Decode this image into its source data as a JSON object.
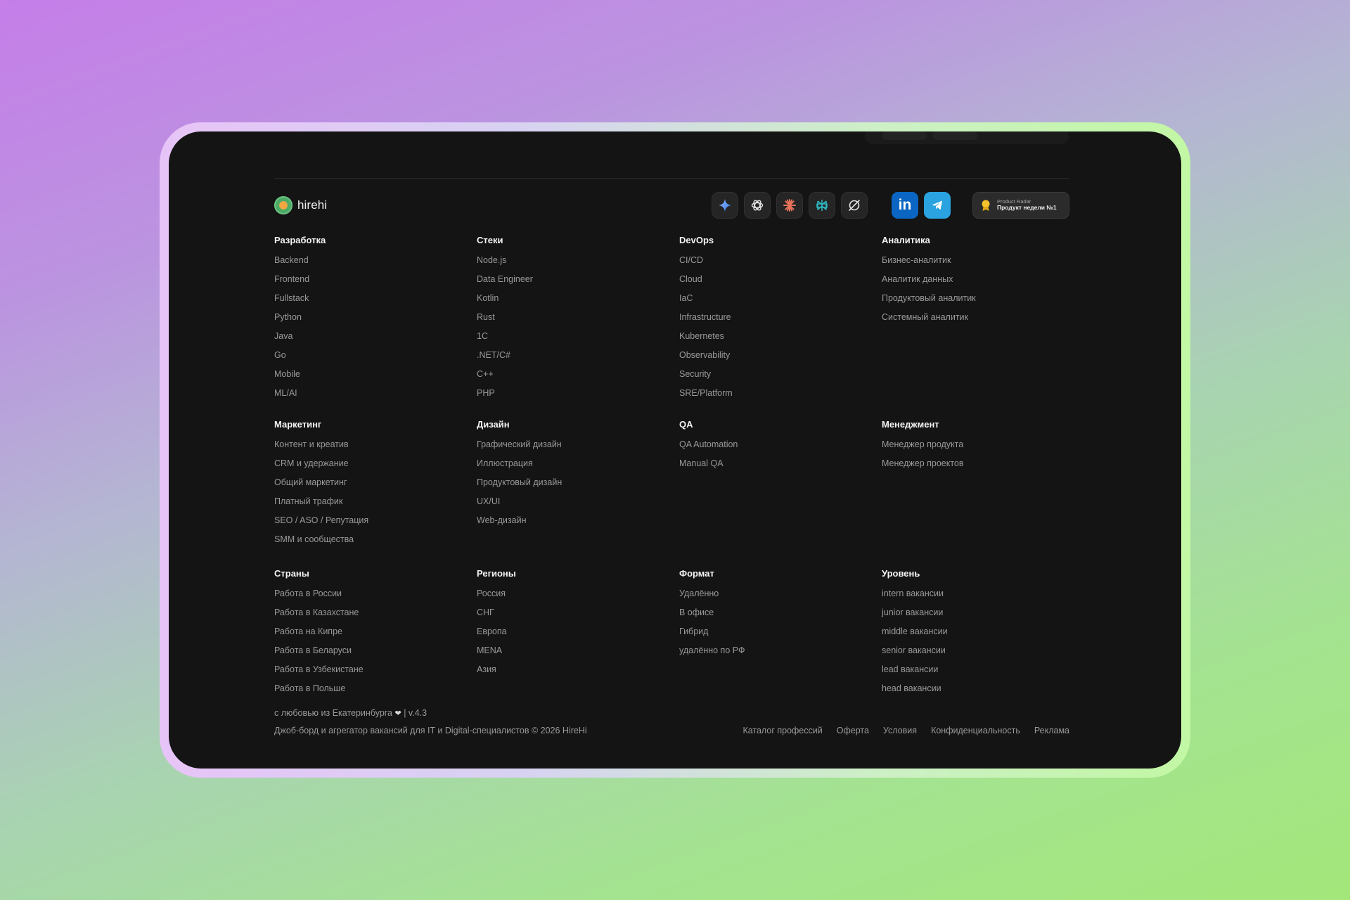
{
  "brand": {
    "name": "hirehi"
  },
  "ai_buttons": [
    {
      "icon": "sparkle-icon",
      "color": "#4f8ff7"
    },
    {
      "icon": "openai-icon",
      "color": "#e6e6e6"
    },
    {
      "icon": "asterisk-icon",
      "color": "#e8735a"
    },
    {
      "icon": "perplexity-icon",
      "color": "#2fb7c2"
    },
    {
      "icon": "grok-icon",
      "color": "#e6e6e6"
    }
  ],
  "social": {
    "linkedin_label": "in",
    "linkedin_color": "#0a66c2",
    "telegram_color": "#2aa3e0"
  },
  "product_radar": {
    "small": "Product Radar",
    "big": "Продукт недели №1"
  },
  "sections": [
    {
      "title": "Разработка",
      "items": [
        "Backend",
        "Frontend",
        "Fullstack",
        "Python",
        "Java",
        "Go",
        "Mobile",
        "ML/AI"
      ]
    },
    {
      "title": "Стеки",
      "items": [
        "Node.js",
        "Data Engineer",
        "Kotlin",
        "Rust",
        "1С",
        ".NET/C#",
        "C++",
        "PHP"
      ]
    },
    {
      "title": "DevOps",
      "items": [
        "CI/CD",
        "Cloud",
        "IaC",
        "Infrastructure",
        "Kubernetes",
        "Observability",
        "Security",
        "SRE/Platform"
      ]
    },
    {
      "title": "Аналитика",
      "items": [
        "Бизнес-аналитик",
        "Аналитик данных",
        "Продуктовый аналитик",
        "Системный аналитик"
      ]
    },
    {
      "title": "Маркетинг",
      "items": [
        "Контент и креатив",
        "CRM и удержание",
        "Общий маркетинг",
        "Платный трафик",
        "SEO / ASO / Репутация",
        "SMM и сообщества"
      ]
    },
    {
      "title": "Дизайн",
      "items": [
        "Графический дизайн",
        "Иллюстрация",
        "Продуктовый дизайн",
        "UX/UI",
        "Web-дизайн"
      ]
    },
    {
      "title": "QA",
      "items": [
        "QA Automation",
        "Manual QA"
      ]
    },
    {
      "title": "Менеджмент",
      "items": [
        "Менеджер продукта",
        "Менеджер проектов"
      ]
    },
    {
      "title": "Страны",
      "items": [
        "Работа в России",
        "Работа в Казахстане",
        "Работа на Кипре",
        "Работа в Беларуси",
        "Работа в Узбекистане",
        "Работа в Польше"
      ]
    },
    {
      "title": "Регионы",
      "items": [
        "Россия",
        "СНГ",
        "Европа",
        "MENA",
        "Азия"
      ]
    },
    {
      "title": "Формат",
      "items": [
        "Удалённо",
        "В офисе",
        "Гибрид",
        "удалённо по РФ"
      ]
    },
    {
      "title": "Уровень",
      "items": [
        "intern вакансии",
        "junior вакансии",
        "middle вакансии",
        "senior вакансии",
        "lead вакансии",
        "head вакансии"
      ]
    }
  ],
  "bottom": {
    "made_with": "с любовью из Екатеринбурга",
    "version": "| v.4.3",
    "copyright": "Джоб-борд и агрегатор вакансий для IT и Digital-специалистов © 2026 HireHi",
    "links": [
      "Каталог профессий",
      "Оферта",
      "Условия",
      "Конфиденциальность",
      "Реклама"
    ]
  }
}
